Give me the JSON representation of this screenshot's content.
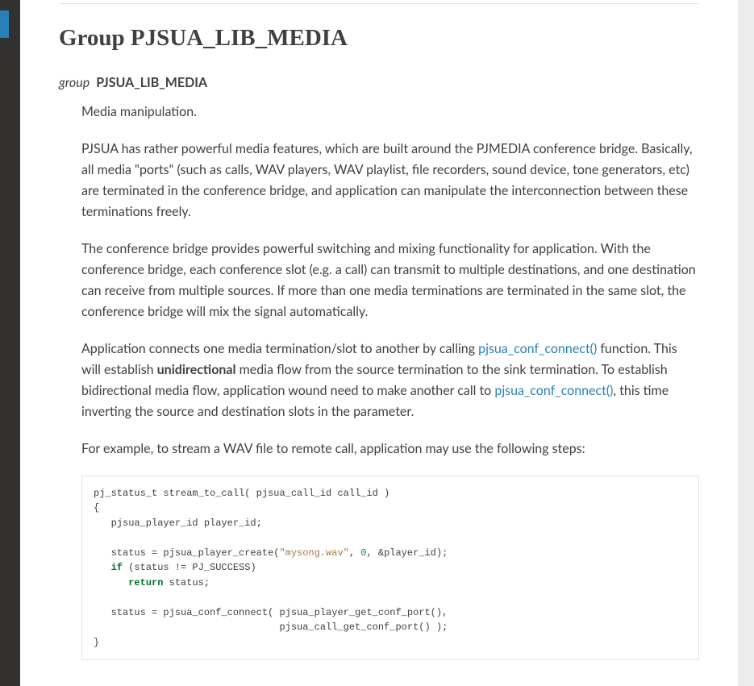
{
  "heading": "Group PJSUA_LIB_MEDIA",
  "signature": {
    "kw": "group",
    "name": "PJSUA_LIB_MEDIA"
  },
  "desc": {
    "short": "Media manipulation.",
    "p1": "PJSUA has rather powerful media features, which are built around the PJMEDIA conference bridge. Basically, all media \"ports\" (such as calls, WAV players, WAV playlist, file recorders, sound device, tone generators, etc) are terminated in the conference bridge, and application can manipulate the interconnection between these terminations freely.",
    "p2": "The conference bridge provides powerful switching and mixing functionality for application. With the conference bridge, each conference slot (e.g. a call) can transmit to multiple destinations, and one destination can receive from multiple sources. If more than one media terminations are terminated in the same slot, the conference bridge will mix the signal automatically.",
    "p3_a": "Application connects one media termination/slot to another by calling ",
    "p3_link1": "pjsua_conf_connect()",
    "p3_b": " function. This will establish ",
    "p3_bold": "unidirectional",
    "p3_c": " media flow from the source termination to the sink termination. To establish bidirectional media flow, application wound need to make another call to ",
    "p3_link2": "pjsua_conf_connect()",
    "p3_d": ", this time inverting the source and destination slots in the parameter.",
    "p4": "For example, to stream a WAV file to remote call, application may use the following steps:"
  },
  "code": {
    "l1_a": "pj_status_t stream_to_call( pjsua_call_id call_id )",
    "l2": "{",
    "l3": "   pjsua_player_id player_id;",
    "l4": "",
    "l5_a": "   status = pjsua_player_create(",
    "l5_str": "\"mysong.wav\"",
    "l5_b": ", ",
    "l5_num": "0",
    "l5_c": ", &player_id);",
    "l6_a": "   ",
    "l6_kw": "if",
    "l6_b": " (status != PJ_SUCCESS)",
    "l7_a": "      ",
    "l7_kw": "return",
    "l7_b": " status;",
    "l8": "",
    "l9": "   status = pjsua_conf_connect( pjsua_player_get_conf_port(),",
    "l10": "                                pjsua_call_get_conf_port() );",
    "l11": "}"
  }
}
